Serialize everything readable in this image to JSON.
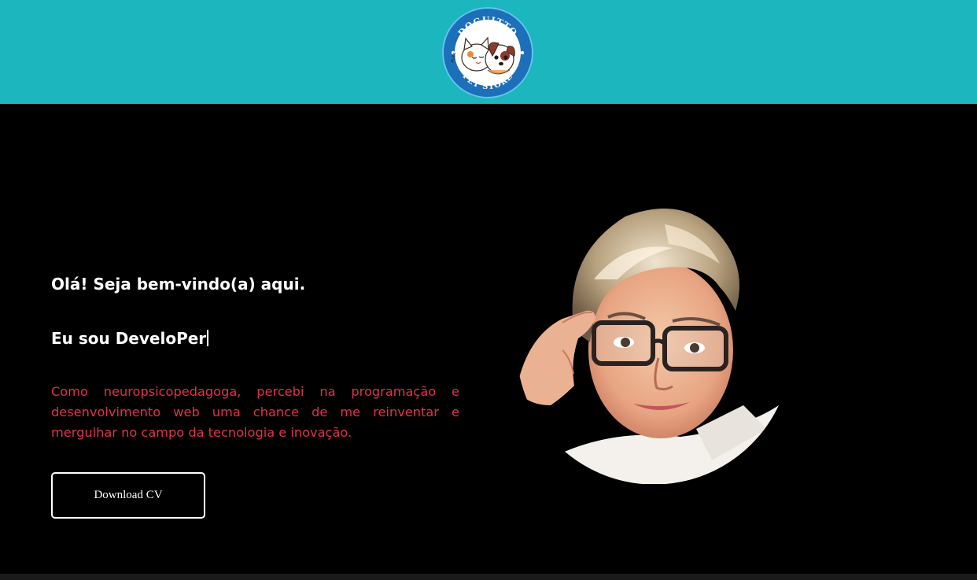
{
  "header": {
    "logo": {
      "top_text": "DOGUITTO",
      "bottom_text": "PET STORE",
      "side_text": "ALBA",
      "icon": "dog-and-cat-logo",
      "ring_color": "#1c6fb8",
      "inner_color": "#ffffff"
    },
    "background_color": "#1bb6be"
  },
  "hero": {
    "greeting": "Olá! Seja bem-vindo(a) aqui.",
    "intro": "Eu sou DeveloPer",
    "description": "Como neuropsicopedagoga, percebi na programação e desenvolvimento web uma chance de me reinventar e mergulhar no campo da tecnologia e inovação.",
    "description_color": "#e0324a",
    "cta_label": "Download CV",
    "portrait_icon": "portrait-avatar-icon"
  }
}
